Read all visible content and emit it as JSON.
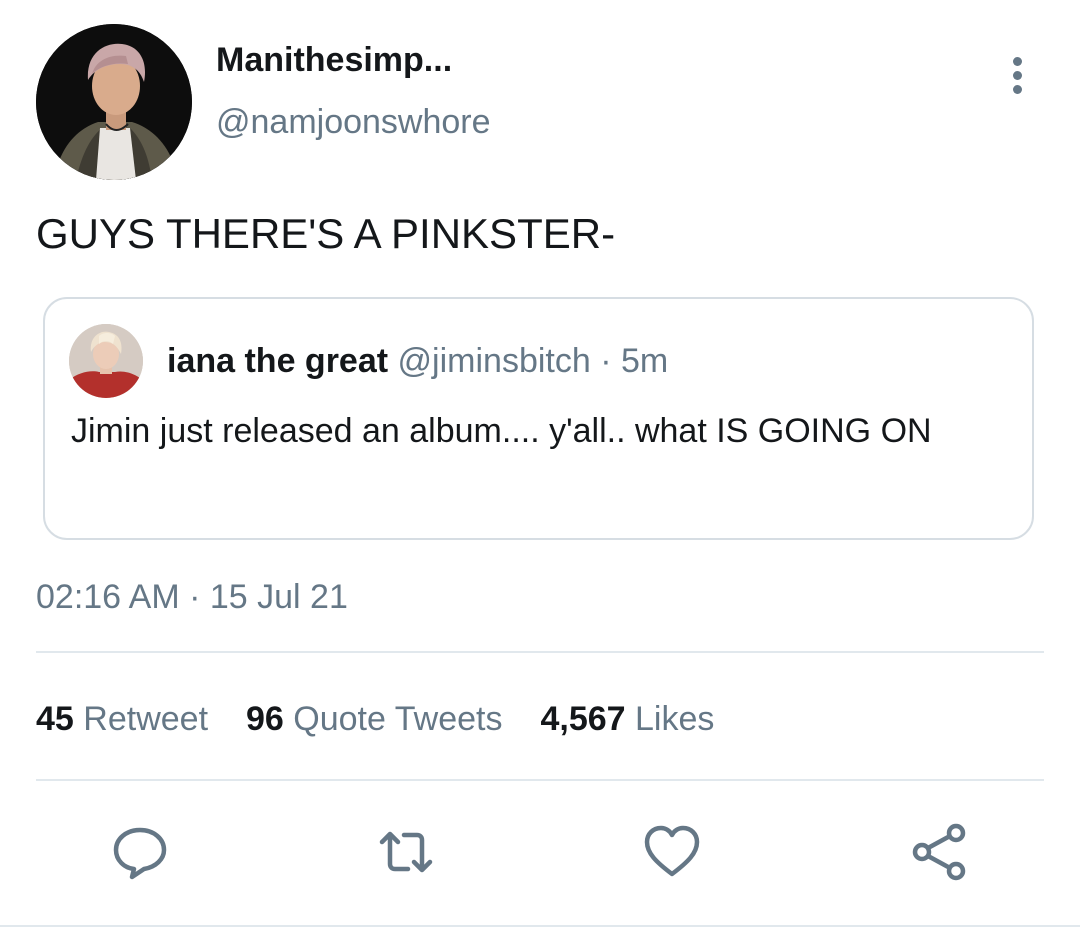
{
  "tweet": {
    "author": {
      "display_name": "Manithesimp...",
      "handle": "@namjoonswhore",
      "avatar_icon": "user-avatar-photo"
    },
    "text": "GUYS THERE'S A PINKSTER-",
    "quoted_tweet": {
      "author_name": "iana the great",
      "handle": "@jiminsbitch",
      "time_ago": "5m",
      "separator": "·",
      "text": "Jimin just released an album.... y'all.. what IS GOING ON",
      "avatar_icon": "user-avatar-photo"
    },
    "timestamp": "02:16 AM · 15 Jul 21",
    "stats": {
      "retweets": {
        "count": "45",
        "label": "Retweet"
      },
      "quote_tweets": {
        "count": "96",
        "label": "Quote Tweets"
      },
      "likes": {
        "count": "4,567",
        "label": "Likes"
      }
    }
  },
  "actions": {
    "icons": [
      "reply-icon",
      "retweet-icon",
      "like-icon",
      "share-icon"
    ]
  },
  "colors": {
    "text_primary": "#14171a",
    "text_secondary": "#657786",
    "border": "#d6dde3",
    "divider": "#e1e8ed",
    "background": "#ffffff"
  }
}
